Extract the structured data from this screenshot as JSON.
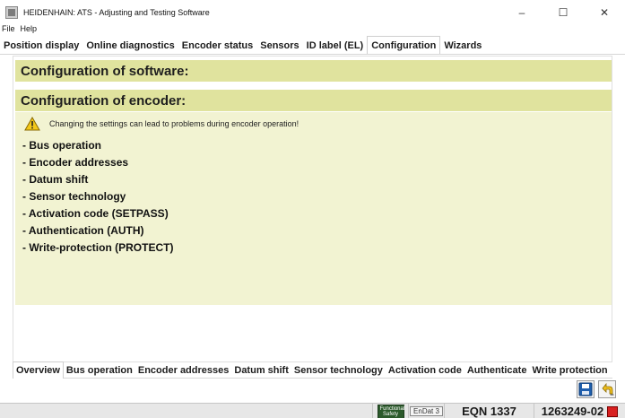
{
  "window": {
    "title": "HEIDENHAIN: ATS - Adjusting and Testing Software",
    "minimize": "–",
    "maximize": "☐",
    "close": "✕"
  },
  "menu": {
    "file": "File",
    "help": "Help"
  },
  "tabs_top": {
    "position_display": "Position display",
    "online_diagnostics": "Online diagnostics",
    "encoder_status": "Encoder status",
    "sensors": "Sensors",
    "id_label": "ID label (EL)",
    "configuration": "Configuration",
    "wizards": "Wizards"
  },
  "content": {
    "software_header": "Configuration of software:",
    "encoder_header": "Configuration of encoder:",
    "warning": "Changing the settings can lead to problems during encoder operation!",
    "items": [
      "- Bus operation",
      "- Encoder addresses",
      "- Datum shift",
      "- Sensor technology",
      "- Activation code (SETPASS)",
      "- Authentication (AUTH)",
      "- Write-protection (PROTECT)"
    ]
  },
  "tabs_bottom": {
    "overview": "Overview",
    "bus_operation": "Bus operation",
    "encoder_addresses": "Encoder addresses",
    "datum_shift": "Datum shift",
    "sensor_technology": "Sensor technology",
    "activation_code": "Activation code",
    "authenticate": "Authenticate",
    "write_protection": "Write protection"
  },
  "statusbar": {
    "functional_safety_line1": "Functional",
    "functional_safety_line2": "Safety",
    "endat": "EnDat 3",
    "encoder": "EQN 1337",
    "id_number": "1263249-02"
  },
  "icons": {
    "save": "save-icon",
    "back": "back-icon",
    "warning": "warning-icon",
    "status": "error-status-icon"
  },
  "colors": {
    "section_header": "#e0e39e",
    "section_body": "#f2f3d2",
    "status_red": "#d82020"
  }
}
